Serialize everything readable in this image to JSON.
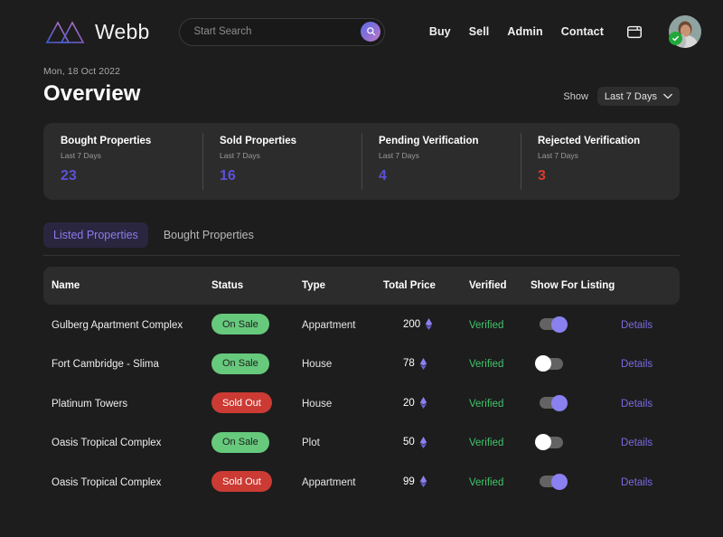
{
  "header": {
    "brand_name": "Webb",
    "logo_icon": "mountain-logo-icon",
    "search": {
      "placeholder": "Start Search",
      "value": "",
      "icon": "search-icon"
    },
    "nav": [
      {
        "label": "Buy"
      },
      {
        "label": "Sell"
      },
      {
        "label": "Admin"
      },
      {
        "label": "Contact"
      }
    ],
    "wallet_icon": "wallet-icon",
    "avatar_icon": "user-avatar",
    "verified_badge_icon": "check-badge-icon"
  },
  "title": {
    "date": "Mon, 18 Oct 2022",
    "heading": "Overview"
  },
  "filter": {
    "show_label": "Show",
    "selected": "Last 7 Days",
    "chevron_icon": "chevron-down-icon"
  },
  "stats": [
    {
      "title": "Bought Properties",
      "sub": "Last 7 Days",
      "value": "23",
      "color": "#5b51d8"
    },
    {
      "title": "Sold Properties",
      "sub": "Last 7 Days",
      "value": "16",
      "color": "#5b51d8"
    },
    {
      "title": "Pending Verification",
      "sub": "Last 7 Days",
      "value": "4",
      "color": "#5b51d8"
    },
    {
      "title": "Rejected Verification",
      "sub": "Last 7 Days",
      "value": "3",
      "color": "#d93b32"
    }
  ],
  "tabs": [
    {
      "label": "Listed Properties",
      "active": true
    },
    {
      "label": "Bought Properties",
      "active": false
    }
  ],
  "table": {
    "columns": {
      "name": "Name",
      "status": "Status",
      "type": "Type",
      "total_price": "Total Price",
      "verified": "Verified",
      "show_for_listing": "Show For Listing"
    },
    "details_label": "Details",
    "currency_icon": "ethereum-icon",
    "rows": [
      {
        "name": "Gulberg Apartment Complex",
        "status": "On Sale",
        "status_kind": "on-sale",
        "type": "Appartment",
        "price": "200",
        "verified": "Verified",
        "listing_on": true
      },
      {
        "name": "Fort Cambridge - Slima",
        "status": "On Sale",
        "status_kind": "on-sale",
        "type": "House",
        "price": "78",
        "verified": "Verified",
        "listing_on": false
      },
      {
        "name": "Platinum Towers",
        "status": "Sold Out",
        "status_kind": "sold-out",
        "type": "House",
        "price": "20",
        "verified": "Verified",
        "listing_on": true
      },
      {
        "name": "Oasis Tropical Complex",
        "status": "On Sale",
        "status_kind": "on-sale",
        "type": "Plot",
        "price": "50",
        "verified": "Verified",
        "listing_on": false
      },
      {
        "name": "Oasis Tropical Complex",
        "status": "Sold Out",
        "status_kind": "sold-out",
        "type": "Appartment",
        "price": "99",
        "verified": "Verified",
        "listing_on": true
      }
    ]
  }
}
